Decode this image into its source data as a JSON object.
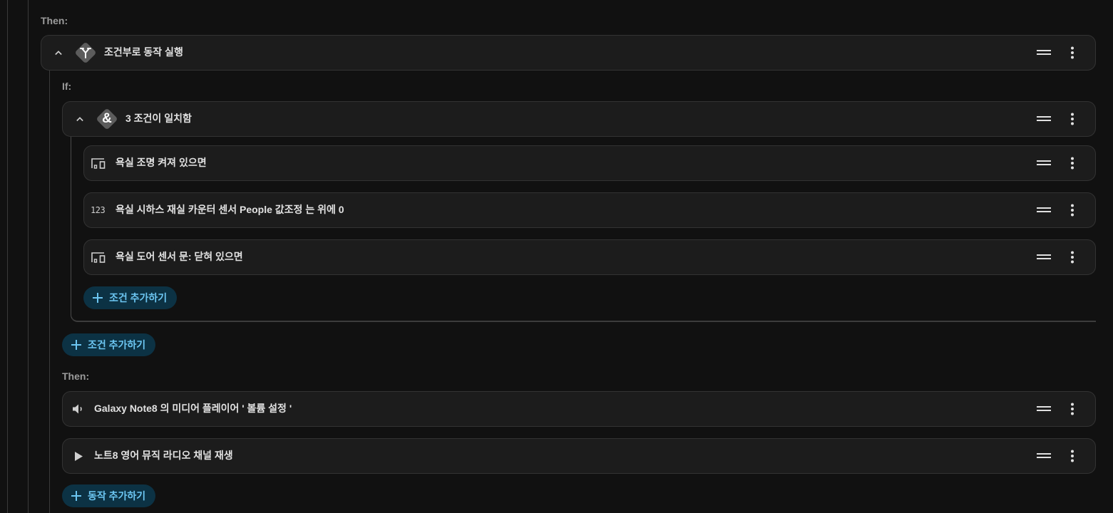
{
  "then_label_1": "Then:",
  "if_label": "If:",
  "then_label_2": "Then:",
  "choose_block": {
    "title": "조건부로 동작 실행",
    "icon": "fork-icon"
  },
  "and_block": {
    "title": "3 조건이 일치함",
    "icon": "ampersand-icon",
    "glyph": "&"
  },
  "conditions": [
    {
      "title": "욕실 조명 켜져 있으면",
      "icon": "devices-icon"
    },
    {
      "title": "욕실 시하스 재실 카운터 센서 People 값조정 는 위에 0",
      "icon": "numeric-icon",
      "icon_text": "123"
    },
    {
      "title": "욕실 도어 센서 문: 닫혀 있으면",
      "icon": "devices-icon"
    }
  ],
  "add_condition_inner": "조건 추가하기",
  "add_condition_outer": "조건 추가하기",
  "actions": [
    {
      "title": "Galaxy Note8 의 미디어 플레이어 ' 볼륨 설정 '",
      "icon": "volume-icon"
    },
    {
      "title": "노트8 영어 뮤직 라디오 채널 재생",
      "icon": "play-icon"
    }
  ],
  "add_action": "동작 추가하기",
  "colors": {
    "background": "#111111",
    "card": "#1c1c1c",
    "accent": "#6cc6f2",
    "button_bg": "#0c3244"
  }
}
